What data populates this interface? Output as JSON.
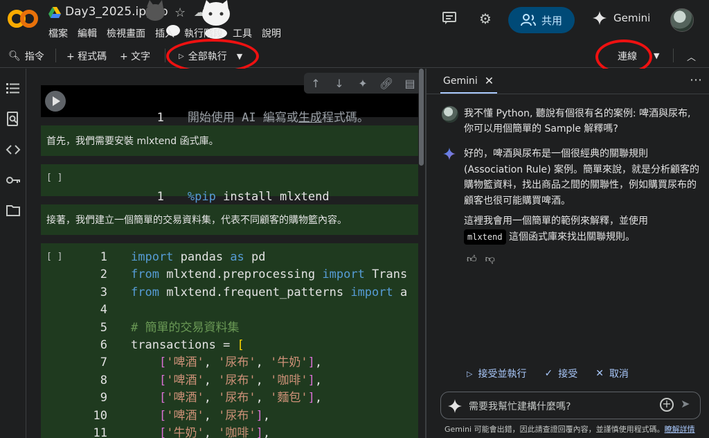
{
  "header": {
    "logo": "CO",
    "title": "Day3_2025.ipynb",
    "menu": [
      "檔案",
      "編輯",
      "檢視畫面",
      "插入",
      "執行階段",
      "工具",
      "說明"
    ],
    "share_label": "共用",
    "gemini_label": "Gemini"
  },
  "toolbar": {
    "command": "指令",
    "add_code": "+ 程式碼",
    "add_text": "+ 文字",
    "run_all": "全部執行",
    "connect": "連線"
  },
  "cells": {
    "cell1_placeholder_pre": "開始使用 AI 編寫或",
    "cell1_placeholder_link": "生成",
    "cell1_placeholder_post": "程式碼。",
    "text1": "首先，我們需要安裝 mlxtend 函式庫。",
    "pip_bracket": "[ ]",
    "pip_line": "install mlxtend",
    "pip_magic": "%pip",
    "text2": "接著，我們建立一個簡單的交易資料集，代表不同顧客的購物籃內容。",
    "code_bracket": "[ ]",
    "code_l2_mod": "mlxtend.preprocessing",
    "code_l2_name": "Trans",
    "code_l3_mod": "mlxtend.frequent_patterns",
    "code_l3_name": "a",
    "code_comment": "# 簡單的交易資料集",
    "code_var": "transactions"
  },
  "gemini": {
    "tab": "Gemini",
    "user_msg": "我不懂 Python, 聽說有個很有名的案例: 啤酒與尿布, 你可以用個簡單的 Sample 解釋嗎?",
    "ai_msg": "好的，啤酒與尿布是一個很經典的關聯規則 (Association Rule) 案例。簡單來說，就是分析顧客的購物籃資料，找出商品之間的關聯性，例如購買尿布的顧客也很可能購買啤酒。",
    "ai_msg2_pre": "這裡我會用一個簡單的範例來解釋，並使用",
    "ai_msg2_chip": "mlxtend",
    "ai_msg2_post": "這個函式庫來找出關聯規則。",
    "accept_run": "接受並執行",
    "accept": "接受",
    "cancel": "取消",
    "input_placeholder": "需要我幫忙建構什麼嗎?",
    "disclaimer": "Gemini 可能會出錯，因此請查證回覆內容，並謹慎使用程式碼。",
    "disclaimer_link": "瞭解詳情"
  },
  "colors": {
    "accent_blue": "#a8c7fa",
    "share_bg": "#004a77",
    "cell_bg": "#1f3a1f",
    "annotation_red": "#ee1111"
  }
}
